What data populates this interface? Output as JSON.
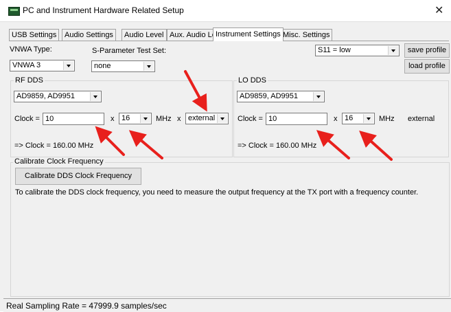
{
  "window": {
    "title": "PC and Instrument Hardware Related Setup",
    "close_glyph": "✕"
  },
  "tabs": [
    {
      "label": "USB Settings"
    },
    {
      "label": "Audio Settings"
    },
    {
      "label": "Audio Level"
    },
    {
      "label": "Aux. Audio Level"
    },
    {
      "label": "Instrument Settings"
    },
    {
      "label": "Misc. Settings"
    }
  ],
  "instrument": {
    "vnwa_type_label": "VNWA Type:",
    "vnwa_type_value": "VNWA 3",
    "sparam_label": "S-Parameter Test Set:",
    "sparam_value": "none",
    "profile_value": "S11 = low",
    "save_profile": "save profile",
    "load_profile": "load profile"
  },
  "rf_dds": {
    "title": "RF DDS",
    "chip": "AD9859, AD9951",
    "clock_label": "Clock =",
    "clock_value": "10",
    "x1": "x",
    "multiplier": "16",
    "mhz": "MHz",
    "x2": "x",
    "source": "external",
    "result": "=> Clock =    160.00 MHz"
  },
  "lo_dds": {
    "title": "LO DDS",
    "chip": "AD9859, AD9951",
    "clock_label": "Clock =",
    "clock_value": "10",
    "x1": "x",
    "multiplier": "16",
    "mhz": "MHz",
    "source_text": "external",
    "result": "=> Clock =    160.00 MHz"
  },
  "calibrate": {
    "title": "Calibrate Clock Frequency",
    "button": "Calibrate DDS Clock Frequency",
    "info": "To calibrate the DDS clock frequency, you need to measure the output frequency at the TX port with a frequency counter."
  },
  "status": {
    "text": "Real Sampling Rate = 47999.9 samples/sec"
  },
  "colors": {
    "annotation_arrow": "#e8201c",
    "window_bg": "#f0f0f0"
  }
}
